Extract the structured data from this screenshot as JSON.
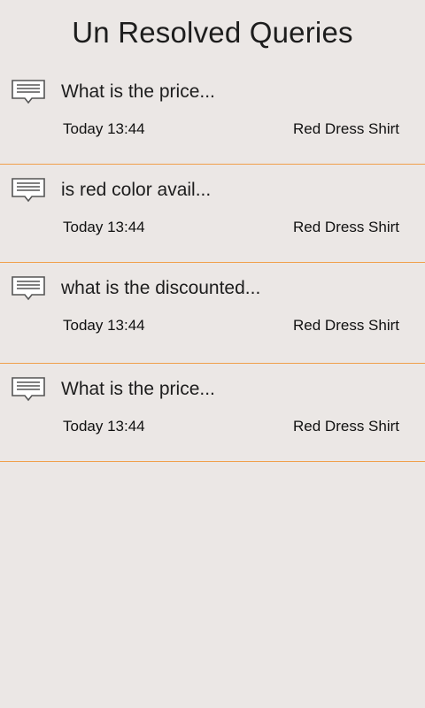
{
  "header": {
    "title": "Un Resolved Queries"
  },
  "queries": [
    {
      "icon": "message-icon",
      "question": "What is the price...",
      "time": "Today 13:44",
      "product": "Red Dress Shirt"
    },
    {
      "icon": "message-icon",
      "question": "is red color avail...",
      "time": "Today 13:44",
      "product": "Red Dress Shirt"
    },
    {
      "icon": "message-icon",
      "question": "what is the discounted...",
      "time": "Today 13:44",
      "product": "Red Dress Shirt"
    },
    {
      "icon": "message-icon",
      "question": "What is the price...",
      "time": "Today 13:44",
      "product": "Red Dress Shirt"
    }
  ],
  "colors": {
    "background": "#ebe7e5",
    "divider": "#f0a04b",
    "text": "#1d1d1d"
  }
}
